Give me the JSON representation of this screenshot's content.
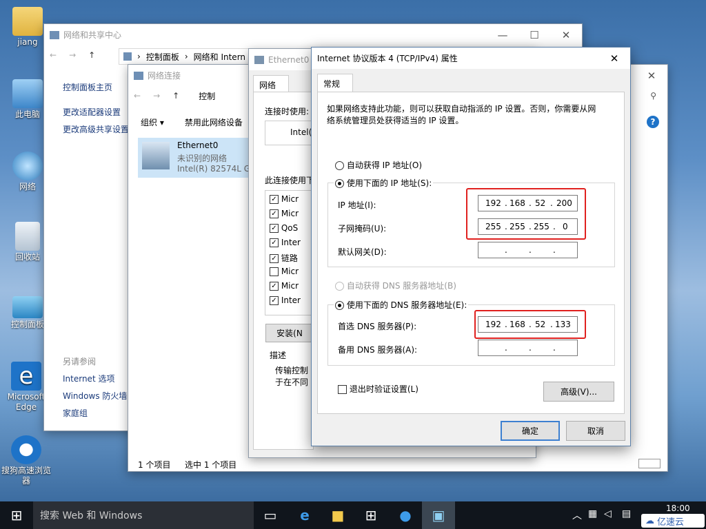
{
  "desktop": {
    "icons": [
      {
        "label": "jiang"
      },
      {
        "label": "此电脑"
      },
      {
        "label": "网络"
      },
      {
        "label": "回收站"
      },
      {
        "label": "控制面板"
      },
      {
        "label": "Microsoft Edge"
      },
      {
        "label": "搜狗高速浏览器"
      }
    ]
  },
  "network_center": {
    "title": "网络和共享中心",
    "breadcrumb": [
      "控制面板",
      "网络和 Intern"
    ],
    "sidebar": [
      "控制面板主页",
      "更改适配器设置",
      "更改高级共享设置"
    ],
    "see_also_title": "另请参阅",
    "see_also": [
      "Internet 选项",
      "Windows 防火墙",
      "家庭组"
    ]
  },
  "connections": {
    "title": "网络连接",
    "breadcrumb": "控制",
    "toolbar": {
      "organize": "组织 ▾",
      "disable": "禁用此网络设备"
    },
    "item": {
      "name": "Ethernet0",
      "status": "未识别的网络",
      "adapter": "Intel(R) 82574L Gi"
    },
    "status_left": "1 个项目",
    "status_selected": "选中 1 个项目"
  },
  "ethernet_props": {
    "title": "Ethernet0",
    "tab": "网络",
    "connect_using": "连接时使用:",
    "adapter": "Intel(",
    "uses_label": "此连接使用下",
    "items": [
      {
        "label": "Micr",
        "checked": true
      },
      {
        "label": "Micr",
        "checked": true
      },
      {
        "label": "QoS",
        "checked": true
      },
      {
        "label": "Inter",
        "checked": true
      },
      {
        "label": "链路",
        "checked": true
      },
      {
        "label": "Micr",
        "checked": false
      },
      {
        "label": "Micr",
        "checked": true
      },
      {
        "label": "Inter",
        "checked": true
      }
    ],
    "install": "安装(N",
    "desc_title": "描述",
    "desc_text1": "传输控制",
    "desc_text2": "于在不同"
  },
  "dialog": {
    "title": "Internet 协议版本 4 (TCP/IPv4) 属性",
    "tab": "常规",
    "intro": "如果网络支持此功能，则可以获取自动指派的 IP 设置。否则，你需要从网络系统管理员处获得适当的 IP 设置。",
    "auto_ip": "自动获得 IP 地址(O)",
    "manual_ip": "使用下面的 IP 地址(S):",
    "ip_label": "IP 地址(I):",
    "ip": [
      "192",
      "168",
      "52",
      "200"
    ],
    "mask_label": "子网掩码(U):",
    "mask": [
      "255",
      "255",
      "255",
      "0"
    ],
    "gw_label": "默认网关(D):",
    "auto_dns": "自动获得 DNS 服务器地址(B)",
    "manual_dns": "使用下面的 DNS 服务器地址(E):",
    "dns1_label": "首选 DNS 服务器(P):",
    "dns1": [
      "192",
      "168",
      "52",
      "133"
    ],
    "dns2_label": "备用 DNS 服务器(A):",
    "validate": "退出时验证设置(L)",
    "advanced": "高级(V)...",
    "ok": "确定",
    "cancel": "取消",
    "dot": "."
  },
  "taskbar": {
    "search": "搜索 Web 和 Windows",
    "time": "18:00",
    "watermark": "亿速云"
  },
  "colors": {
    "highlight_red": "#e0201e",
    "accent": "#3c7fd0"
  }
}
